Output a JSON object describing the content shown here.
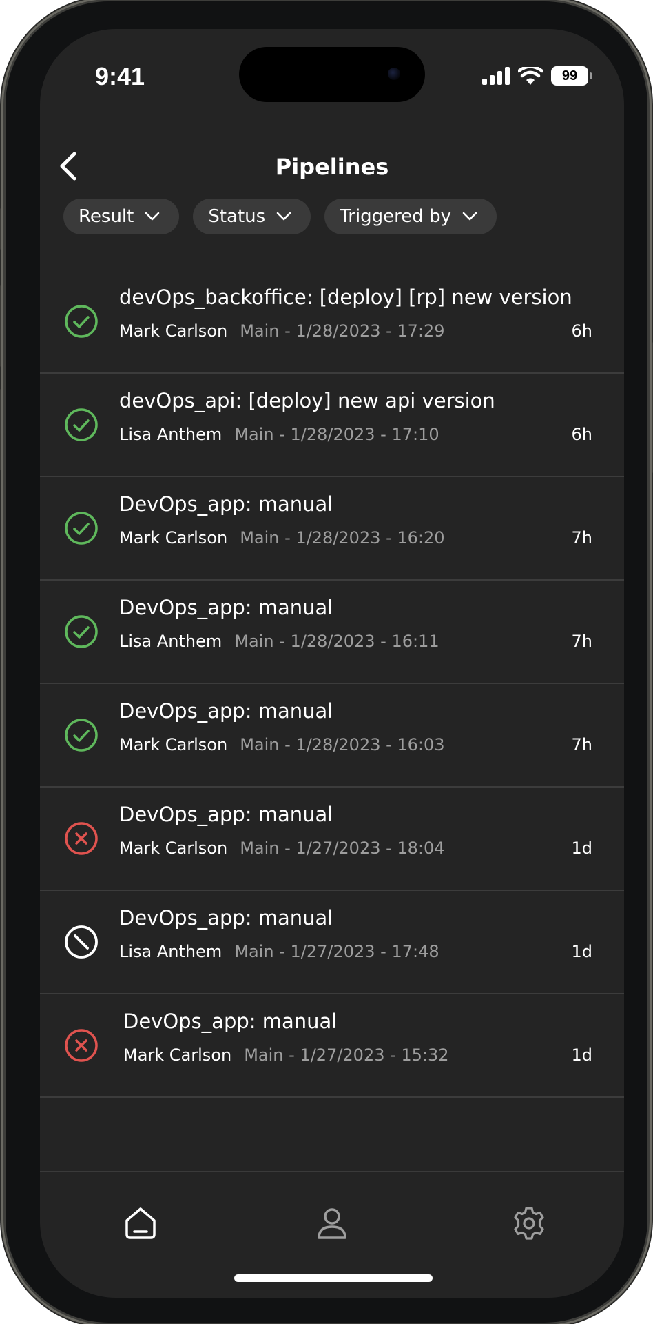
{
  "status_bar": {
    "time": "9:41",
    "battery": "99",
    "icons": [
      "cellular-signal-icon",
      "wifi-icon",
      "battery-icon"
    ]
  },
  "header": {
    "title": "Pipelines",
    "back_icon": "chevron-left-icon"
  },
  "filters": [
    {
      "label": "Result"
    },
    {
      "label": "Status"
    },
    {
      "label": "Triggered by"
    }
  ],
  "pipelines": [
    {
      "title": "devOps_backoffice: [deploy] [rp] new version",
      "author": "Mark Carlson",
      "branch": "Main - 1/28/2023 - 17:29",
      "age": "6h",
      "result": "success"
    },
    {
      "title": "devOps_api: [deploy] new api version",
      "author": "Lisa Anthem",
      "branch": "Main - 1/28/2023 - 17:10",
      "age": "6h",
      "result": "success"
    },
    {
      "title": "DevOps_app: manual",
      "author": "Mark Carlson",
      "branch": "Main - 1/28/2023 - 16:20",
      "age": "7h",
      "result": "success"
    },
    {
      "title": "DevOps_app: manual",
      "author": "Lisa Anthem",
      "branch": "Main - 1/28/2023 - 16:11",
      "age": "7h",
      "result": "success"
    },
    {
      "title": "DevOps_app: manual",
      "author": "Mark Carlson",
      "branch": "Main - 1/28/2023 - 16:03",
      "age": "7h",
      "result": "success"
    },
    {
      "title": "DevOps_app: manual",
      "author": "Mark Carlson",
      "branch": "Main - 1/27/2023 - 18:04",
      "age": "1d",
      "result": "failed"
    },
    {
      "title": "DevOps_app: manual",
      "author": "Lisa Anthem",
      "branch": "Main - 1/27/2023 - 17:48",
      "age": "1d",
      "result": "canceled"
    },
    {
      "title": "DevOps_app: manual",
      "author": "Mark Carlson",
      "branch": "Main - 1/27/2023 - 15:32",
      "age": "1d",
      "result": "failed"
    }
  ],
  "tabbar": {
    "items": [
      "home-icon",
      "profile-icon",
      "settings-icon"
    ]
  },
  "colors": {
    "background": "#242424",
    "success": "#5fb85c",
    "failed": "#e0534f",
    "canceled": "#ffffff",
    "secondary_text": "#9e9e9e",
    "chip": "#3a3a3a"
  }
}
